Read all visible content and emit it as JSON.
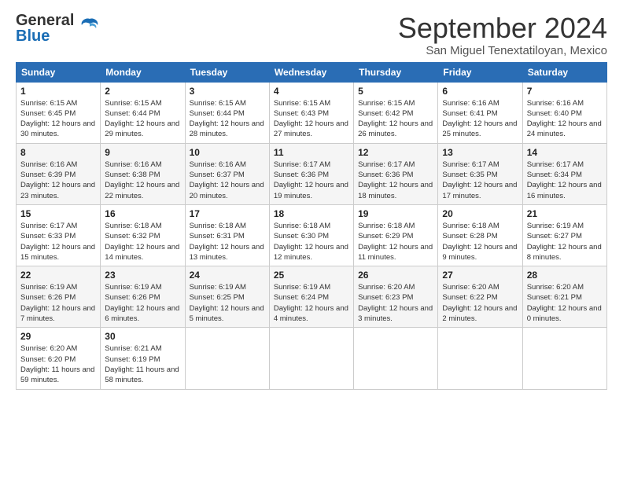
{
  "logo": {
    "line1": "General",
    "line2": "Blue"
  },
  "title": "September 2024",
  "subtitle": "San Miguel Tenextatiloyan, Mexico",
  "days_of_week": [
    "Sunday",
    "Monday",
    "Tuesday",
    "Wednesday",
    "Thursday",
    "Friday",
    "Saturday"
  ],
  "weeks": [
    [
      {
        "day": 1,
        "sunrise": "Sunrise: 6:15 AM",
        "sunset": "Sunset: 6:45 PM",
        "daylight": "Daylight: 12 hours and 30 minutes."
      },
      {
        "day": 2,
        "sunrise": "Sunrise: 6:15 AM",
        "sunset": "Sunset: 6:44 PM",
        "daylight": "Daylight: 12 hours and 29 minutes."
      },
      {
        "day": 3,
        "sunrise": "Sunrise: 6:15 AM",
        "sunset": "Sunset: 6:44 PM",
        "daylight": "Daylight: 12 hours and 28 minutes."
      },
      {
        "day": 4,
        "sunrise": "Sunrise: 6:15 AM",
        "sunset": "Sunset: 6:43 PM",
        "daylight": "Daylight: 12 hours and 27 minutes."
      },
      {
        "day": 5,
        "sunrise": "Sunrise: 6:15 AM",
        "sunset": "Sunset: 6:42 PM",
        "daylight": "Daylight: 12 hours and 26 minutes."
      },
      {
        "day": 6,
        "sunrise": "Sunrise: 6:16 AM",
        "sunset": "Sunset: 6:41 PM",
        "daylight": "Daylight: 12 hours and 25 minutes."
      },
      {
        "day": 7,
        "sunrise": "Sunrise: 6:16 AM",
        "sunset": "Sunset: 6:40 PM",
        "daylight": "Daylight: 12 hours and 24 minutes."
      }
    ],
    [
      {
        "day": 8,
        "sunrise": "Sunrise: 6:16 AM",
        "sunset": "Sunset: 6:39 PM",
        "daylight": "Daylight: 12 hours and 23 minutes."
      },
      {
        "day": 9,
        "sunrise": "Sunrise: 6:16 AM",
        "sunset": "Sunset: 6:38 PM",
        "daylight": "Daylight: 12 hours and 22 minutes."
      },
      {
        "day": 10,
        "sunrise": "Sunrise: 6:16 AM",
        "sunset": "Sunset: 6:37 PM",
        "daylight": "Daylight: 12 hours and 20 minutes."
      },
      {
        "day": 11,
        "sunrise": "Sunrise: 6:17 AM",
        "sunset": "Sunset: 6:36 PM",
        "daylight": "Daylight: 12 hours and 19 minutes."
      },
      {
        "day": 12,
        "sunrise": "Sunrise: 6:17 AM",
        "sunset": "Sunset: 6:36 PM",
        "daylight": "Daylight: 12 hours and 18 minutes."
      },
      {
        "day": 13,
        "sunrise": "Sunrise: 6:17 AM",
        "sunset": "Sunset: 6:35 PM",
        "daylight": "Daylight: 12 hours and 17 minutes."
      },
      {
        "day": 14,
        "sunrise": "Sunrise: 6:17 AM",
        "sunset": "Sunset: 6:34 PM",
        "daylight": "Daylight: 12 hours and 16 minutes."
      }
    ],
    [
      {
        "day": 15,
        "sunrise": "Sunrise: 6:17 AM",
        "sunset": "Sunset: 6:33 PM",
        "daylight": "Daylight: 12 hours and 15 minutes."
      },
      {
        "day": 16,
        "sunrise": "Sunrise: 6:18 AM",
        "sunset": "Sunset: 6:32 PM",
        "daylight": "Daylight: 12 hours and 14 minutes."
      },
      {
        "day": 17,
        "sunrise": "Sunrise: 6:18 AM",
        "sunset": "Sunset: 6:31 PM",
        "daylight": "Daylight: 12 hours and 13 minutes."
      },
      {
        "day": 18,
        "sunrise": "Sunrise: 6:18 AM",
        "sunset": "Sunset: 6:30 PM",
        "daylight": "Daylight: 12 hours and 12 minutes."
      },
      {
        "day": 19,
        "sunrise": "Sunrise: 6:18 AM",
        "sunset": "Sunset: 6:29 PM",
        "daylight": "Daylight: 12 hours and 11 minutes."
      },
      {
        "day": 20,
        "sunrise": "Sunrise: 6:18 AM",
        "sunset": "Sunset: 6:28 PM",
        "daylight": "Daylight: 12 hours and 9 minutes."
      },
      {
        "day": 21,
        "sunrise": "Sunrise: 6:19 AM",
        "sunset": "Sunset: 6:27 PM",
        "daylight": "Daylight: 12 hours and 8 minutes."
      }
    ],
    [
      {
        "day": 22,
        "sunrise": "Sunrise: 6:19 AM",
        "sunset": "Sunset: 6:26 PM",
        "daylight": "Daylight: 12 hours and 7 minutes."
      },
      {
        "day": 23,
        "sunrise": "Sunrise: 6:19 AM",
        "sunset": "Sunset: 6:26 PM",
        "daylight": "Daylight: 12 hours and 6 minutes."
      },
      {
        "day": 24,
        "sunrise": "Sunrise: 6:19 AM",
        "sunset": "Sunset: 6:25 PM",
        "daylight": "Daylight: 12 hours and 5 minutes."
      },
      {
        "day": 25,
        "sunrise": "Sunrise: 6:19 AM",
        "sunset": "Sunset: 6:24 PM",
        "daylight": "Daylight: 12 hours and 4 minutes."
      },
      {
        "day": 26,
        "sunrise": "Sunrise: 6:20 AM",
        "sunset": "Sunset: 6:23 PM",
        "daylight": "Daylight: 12 hours and 3 minutes."
      },
      {
        "day": 27,
        "sunrise": "Sunrise: 6:20 AM",
        "sunset": "Sunset: 6:22 PM",
        "daylight": "Daylight: 12 hours and 2 minutes."
      },
      {
        "day": 28,
        "sunrise": "Sunrise: 6:20 AM",
        "sunset": "Sunset: 6:21 PM",
        "daylight": "Daylight: 12 hours and 0 minutes."
      }
    ],
    [
      {
        "day": 29,
        "sunrise": "Sunrise: 6:20 AM",
        "sunset": "Sunset: 6:20 PM",
        "daylight": "Daylight: 11 hours and 59 minutes."
      },
      {
        "day": 30,
        "sunrise": "Sunrise: 6:21 AM",
        "sunset": "Sunset: 6:19 PM",
        "daylight": "Daylight: 11 hours and 58 minutes."
      },
      null,
      null,
      null,
      null,
      null
    ]
  ]
}
